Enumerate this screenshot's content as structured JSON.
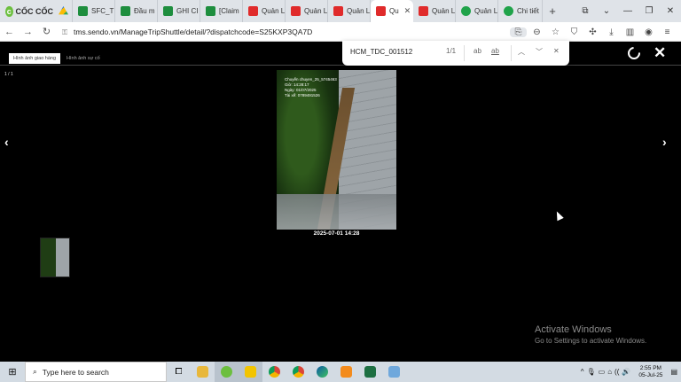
{
  "browser": {
    "brand": "CỐC CỐC",
    "tabs": [
      {
        "label": "",
        "icon": "drive"
      },
      {
        "label": "SFC_TI",
        "icon": "sheet"
      },
      {
        "label": "Đầu m",
        "icon": "sheet"
      },
      {
        "label": "GHI CI",
        "icon": "sheet"
      },
      {
        "label": "[Claim",
        "icon": "sheet"
      },
      {
        "label": "Quản L",
        "icon": "sendo"
      },
      {
        "label": "Quản L",
        "icon": "sendo"
      },
      {
        "label": "Quản L",
        "icon": "sendo"
      },
      {
        "label": "Qu",
        "icon": "sendo",
        "active": true
      },
      {
        "label": "Quản L",
        "icon": "sendo"
      },
      {
        "label": "Quản L",
        "icon": "g"
      },
      {
        "label": "Chi tiết",
        "icon": "g"
      }
    ],
    "url": "tms.sendo.vn/ManageTripShuttle/detail/?dispatchcode=S25KXP3QA7D"
  },
  "find": {
    "query": "HCM_TDC_001512",
    "count": "1/1",
    "match_case": "ab",
    "whole_word": "ab"
  },
  "viewer": {
    "tabs": [
      "Hình ảnh giao hàng",
      "Hình ảnh sự cố"
    ],
    "counter": "1 / 1",
    "photo_overlay": "Chuyến chuyen_25_5745463\nGiờ: 14:28:17\nNgày: 01/07/2025\nTài xế: 0789491526",
    "caption": "2025-07-01 14:28"
  },
  "watermark": {
    "line1": "Activate Windows",
    "line2": "Go to Settings to activate Windows."
  },
  "taskbar": {
    "search_placeholder": "Type here to search",
    "time": "2:55 PM",
    "date": "05-Jul-25"
  }
}
